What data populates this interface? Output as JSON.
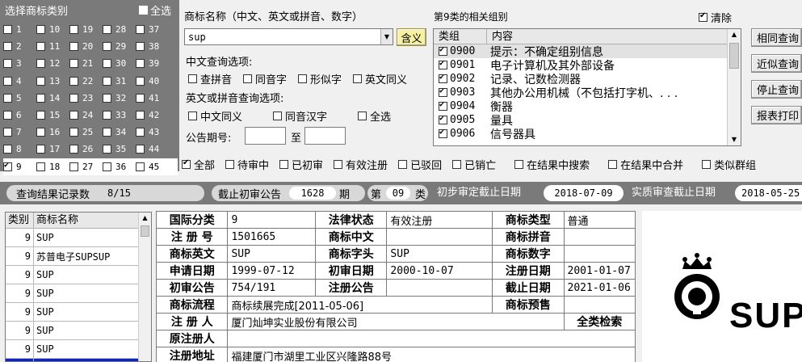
{
  "class_panel": {
    "title": "选择商标类别",
    "select_all": "全选",
    "selected": "9",
    "rows": [
      [
        "1",
        "10",
        "19",
        "28",
        "37"
      ],
      [
        "2",
        "11",
        "20",
        "29",
        "38"
      ],
      [
        "3",
        "12",
        "21",
        "30",
        "39"
      ],
      [
        "4",
        "13",
        "22",
        "31",
        "40"
      ],
      [
        "5",
        "14",
        "23",
        "32",
        "41"
      ],
      [
        "6",
        "15",
        "24",
        "33",
        "42"
      ],
      [
        "7",
        "16",
        "25",
        "34",
        "43"
      ],
      [
        "8",
        "17",
        "26",
        "35",
        "44"
      ],
      [
        "9",
        "18",
        "27",
        "36",
        "45"
      ]
    ]
  },
  "query": {
    "name_label": "商标名称（中文、英文或拼音、数字）",
    "name_value": "sup",
    "meaning_button": "含义",
    "cn_options_label": "中文查询选项:",
    "cn_options": [
      "查拼音",
      "同音字",
      "形似字",
      "英文同义"
    ],
    "en_options_label": "英文或拼音查询选项:",
    "en_options": [
      "中文同义",
      "同音汉字",
      "全选"
    ],
    "issue_label": "公告期号:",
    "issue_to": "至",
    "issue_from_value": "",
    "issue_to_value": ""
  },
  "groups": {
    "title": "第9类的相关组别",
    "clear_label": "清除",
    "col_group": "类组",
    "col_content": "内容",
    "rows": [
      {
        "code": "0900",
        "content": "提示：不确定组别信息"
      },
      {
        "code": "0901",
        "content": "电子计算机及其外部设备"
      },
      {
        "code": "0902",
        "content": "记录、记数检测器"
      },
      {
        "code": "0903",
        "content": "其他办公用机械（不包括打字机、. . ."
      },
      {
        "code": "0904",
        "content": "衡器"
      },
      {
        "code": "0905",
        "content": "量具"
      },
      {
        "code": "0906",
        "content": "信号器具"
      }
    ]
  },
  "side_buttons": [
    "相同查询",
    "近似查询",
    "停止查询",
    "报表打印"
  ],
  "filters": [
    {
      "label": "全部",
      "checked": true
    },
    {
      "label": "待审中",
      "checked": false
    },
    {
      "label": "已初审",
      "checked": false
    },
    {
      "label": "有效注册",
      "checked": false
    },
    {
      "label": "已驳回",
      "checked": false
    },
    {
      "label": "已销亡",
      "checked": false
    },
    {
      "label": "在结果中搜索",
      "checked": false
    },
    {
      "label": "在结果中合并",
      "checked": false
    },
    {
      "label": "类似群组",
      "checked": false
    }
  ],
  "status": {
    "records_label": "查询结果记录数",
    "records_value": "8/15",
    "deadline_label": "截止初审公告",
    "deadline_value": "1628",
    "period_unit": "期",
    "issue_prefix": "第",
    "issue_no": "09",
    "issue_class": "类",
    "prelim_label": "初步审定截止日期",
    "prelim_date": "2018-07-09",
    "substantive_label": "实质审查截止日期",
    "substantive_date": "2018-05-25"
  },
  "results": {
    "col_class": "类别",
    "col_name": "商标名称",
    "rows": [
      {
        "cls": "9",
        "name": "SUP"
      },
      {
        "cls": "9",
        "name": "苏普电子SUPSUP"
      },
      {
        "cls": "9",
        "name": "SUP"
      },
      {
        "cls": "9",
        "name": "SUP"
      },
      {
        "cls": "9",
        "name": "SUP"
      },
      {
        "cls": "9",
        "name": "SUP"
      },
      {
        "cls": "9",
        "name": "SUP"
      },
      {
        "cls": "",
        "name": ""
      }
    ]
  },
  "detail": {
    "intl_class_label": "国际分类",
    "intl_class": "9",
    "legal_status_label": "法律状态",
    "legal_status": "有效注册",
    "type_label": "商标类型",
    "type": "普通",
    "reg_no_label": "注 册 号",
    "reg_no": "1501665",
    "cn_label": "商标中文",
    "cn": "",
    "pinyin_label": "商标拼音",
    "pinyin": "",
    "en_label": "商标英文",
    "en": "SUP",
    "head_label": "商标字头",
    "head": "SUP",
    "num_label": "商标数字",
    "num": "",
    "apply_date_label": "申请日期",
    "apply_date": "1999-07-12",
    "prelim_date_label": "初审日期",
    "prelim_date": "2000-10-07",
    "reg_date_label": "注册日期",
    "reg_date": "2001-01-07",
    "prelim_notice_label": "初审公告",
    "prelim_notice": "754/191",
    "reg_notice_label": "注册公告",
    "reg_notice": "",
    "expire_label": "截止日期",
    "expire": "2021-01-06",
    "flow_label": "商标流程",
    "flow": "商标续展完成[2011-05-06]",
    "pre_label": "商标预售",
    "pre": "",
    "owner_label": "注 册 人",
    "owner": "厦门灿坤实业股份有限公司",
    "full_search": "全类检索",
    "orig_owner_label": "原注册人",
    "orig_owner": "",
    "address_label": "注册地址",
    "address": "福建厦门市湖里工业区兴隆路88号"
  },
  "logo": {
    "text": "SUP"
  }
}
